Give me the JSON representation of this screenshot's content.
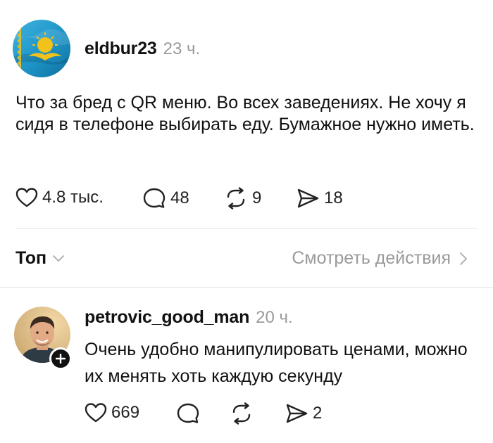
{
  "post": {
    "username": "eldbur23",
    "time": "23 ч.",
    "text": "Что за бред с QR меню. Во всех заведениях. Не хочу я сидя в телефоне выбирать еду. Бумажное нужно иметь.",
    "likes": "4.8 тыс.",
    "comments": "48",
    "reposts": "9",
    "shares": "18"
  },
  "sort": {
    "label": "Топ",
    "activity_link": "Смотреть действия"
  },
  "reply": {
    "username": "petrovic_good_man",
    "time": "20 ч.",
    "text": "Очень удобно манипулировать ценами, можно их менять хоть каждую секунду",
    "likes": "669",
    "shares": "2"
  },
  "colors": {
    "flag_blue": "#2aa6d6",
    "flag_gold": "#f2c21a",
    "muted_text": "#9a9a9a",
    "divider": "#e6e6e6"
  }
}
